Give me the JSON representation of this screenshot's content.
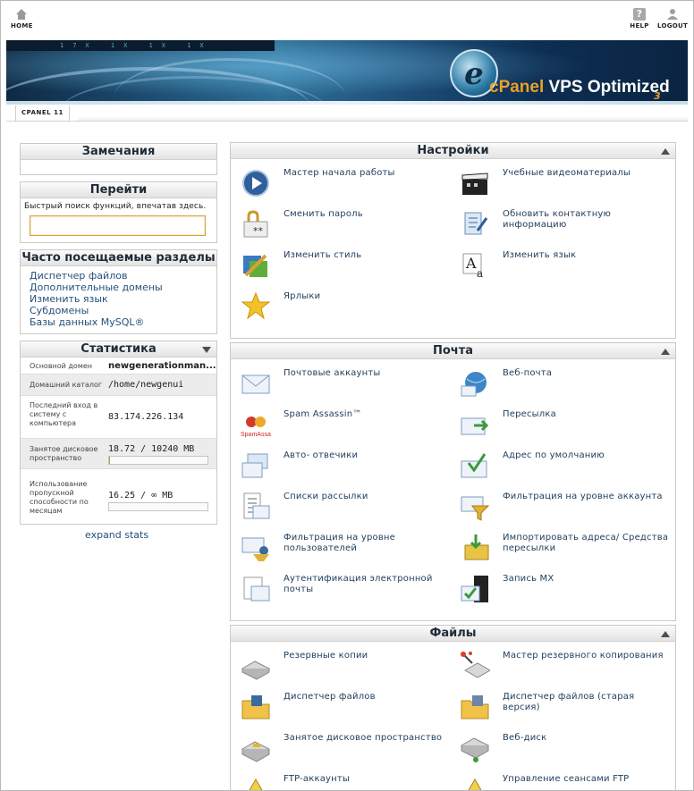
{
  "topbar": {
    "home": "HOME",
    "help": "HELP",
    "logout": "LOGOUT"
  },
  "banner": {
    "logo_text": "cPanel",
    "product": "VPS Optimized",
    "version": "3",
    "strip": "17X 1X 1X 1X"
  },
  "breadcrumb": "CPANEL 11",
  "notes": {
    "title": "Замечания"
  },
  "goto": {
    "title": "Перейти",
    "hint": "Быстрый поиск функций, впечатав здесь.",
    "placeholder": ""
  },
  "frequent": {
    "title": "Часто посещаемые разделы",
    "items": [
      "Диспетчер файлов",
      "Дополнительные домены",
      "Изменить язык",
      "Субдомены",
      "Базы данных MySQL®"
    ]
  },
  "stats": {
    "title": "Статистика",
    "rows": [
      {
        "label": "Основной домен",
        "value": "newgenerationman..."
      },
      {
        "label": "Домашний каталог",
        "value": "/home/newgenui"
      },
      {
        "label": "Последний вход в систему с компьютера",
        "value": "83.174.226.134"
      },
      {
        "label": "Занятое дисковое пространство",
        "value": "18.72 / 10240 MB",
        "usage": 0.0018
      },
      {
        "label": "Использование пропускной способности по месяцам",
        "value": "16.25 / ∞ MB",
        "usage": 0
      }
    ],
    "expand": "expand stats"
  },
  "sections": [
    {
      "title": "Настройки",
      "items": [
        {
          "label": "Мастер начала работы",
          "icon": "play-icon"
        },
        {
          "label": "Учебные видеоматериалы",
          "icon": "clapper-icon"
        },
        {
          "label": "Сменить пароль",
          "icon": "lock-icon"
        },
        {
          "label": "Обновить контактную информацию",
          "icon": "contact-icon"
        },
        {
          "label": "Изменить стиль",
          "icon": "palette-icon"
        },
        {
          "label": "Изменить язык",
          "icon": "language-icon"
        },
        {
          "label": "Ярлыки",
          "icon": "star-icon"
        }
      ]
    },
    {
      "title": "Почта",
      "items": [
        {
          "label": "Почтовые аккаунты",
          "icon": "envelope-icon"
        },
        {
          "label": "Веб-почта",
          "icon": "globe-mail-icon"
        },
        {
          "label": "Spam Assassin™",
          "icon": "spamassassin-icon"
        },
        {
          "label": "Пересылка",
          "icon": "forward-icon"
        },
        {
          "label": "Авто- отвечики",
          "icon": "autoresponder-icon"
        },
        {
          "label": "Адрес по умолчанию",
          "icon": "default-address-icon"
        },
        {
          "label": "Списки рассылки",
          "icon": "mailing-list-icon"
        },
        {
          "label": "Фильтрация на уровне аккаунта",
          "icon": "filter-icon"
        },
        {
          "label": "Фильтрация на уровне пользователей",
          "icon": "user-filter-icon"
        },
        {
          "label": "Импортировать адреса/ Средства пересылки",
          "icon": "import-icon"
        },
        {
          "label": "Аутентификация электронной почты",
          "icon": "auth-mail-icon"
        },
        {
          "label": "Запись MX",
          "icon": "mx-record-icon"
        }
      ]
    },
    {
      "title": "Файлы",
      "items": [
        {
          "label": "Резервные копии",
          "icon": "backup-icon"
        },
        {
          "label": "Мастер резервного копирования",
          "icon": "backup-wizard-icon"
        },
        {
          "label": "Диспетчер файлов",
          "icon": "folder-icon"
        },
        {
          "label": "Диспетчер файлов (старая версия)",
          "icon": "folder-old-icon"
        },
        {
          "label": "Занятое дисковое пространство",
          "icon": "disk-usage-icon"
        },
        {
          "label": "Веб-диск",
          "icon": "web-disk-icon"
        },
        {
          "label": "FTP-аккаунты",
          "icon": "ftp-icon"
        },
        {
          "label": "Управление сеансами FTP",
          "icon": "ftp-session-icon"
        }
      ]
    }
  ]
}
